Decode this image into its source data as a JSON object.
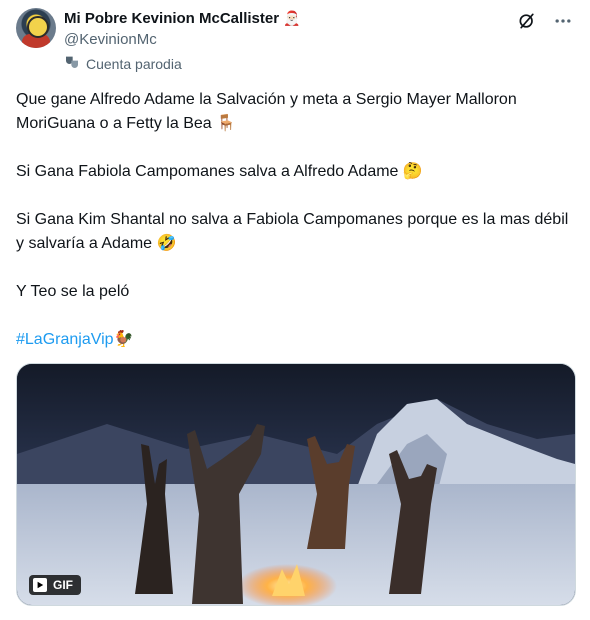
{
  "user": {
    "display_name": "Mi Pobre Kevinion McCallister",
    "name_emoji": "🎅🏻",
    "handle": "@KevinionMc",
    "parody_label": "Cuenta parodia"
  },
  "actions": {
    "grok_icon": "grok-icon",
    "more_icon": "more-icon"
  },
  "tweet": {
    "para1": "Que gane Alfredo Adame la Salvación y meta a Sergio Mayer Malloron MoriGuana o a Fetty la Bea",
    "para1_emoji": "🪑",
    "para2": "Si Gana Fabiola Campomanes salva a Alfredo Adame",
    "para2_emoji": "🤔",
    "para3": "Si Gana Kim Shantal no salva a Fabiola Campomanes porque es la mas débil y salvaría a Adame",
    "para3_emoji": "🤣",
    "para4": "Y Teo se la peló",
    "hashtag": "#LaGranjaVip",
    "hashtag_emoji": "🐓"
  },
  "media": {
    "badge": "GIF"
  },
  "colors": {
    "link": "#1d9bf0",
    "secondary": "#536471"
  }
}
